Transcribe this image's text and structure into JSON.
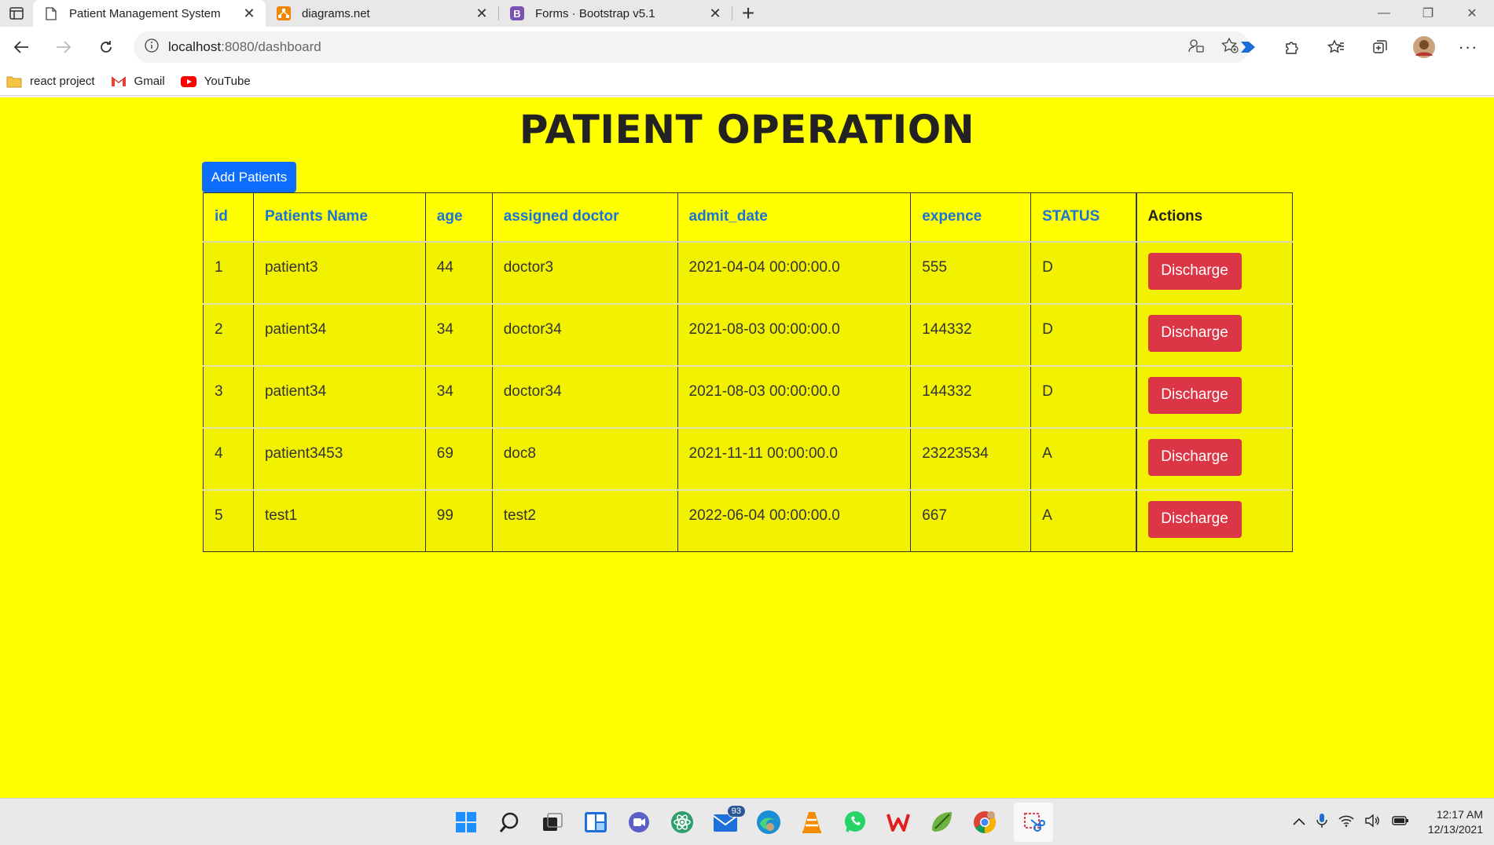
{
  "browser": {
    "tabs": [
      {
        "label": "Patient Management System",
        "active": true,
        "icon": "page-icon"
      },
      {
        "label": "diagrams.net",
        "active": false,
        "icon": "diagrams-icon"
      },
      {
        "label": "Forms · Bootstrap v5.1",
        "active": false,
        "icon": "bootstrap-icon"
      }
    ],
    "url_host": "localhost",
    "url_path": ":8080/dashboard",
    "bookmarks": [
      {
        "label": "react project",
        "icon": "folder-icon"
      },
      {
        "label": "Gmail",
        "icon": "gmail-icon"
      },
      {
        "label": "YouTube",
        "icon": "youtube-icon"
      }
    ]
  },
  "page": {
    "title": "PATIENT OPERATION",
    "add_button": "Add Patients",
    "columns": [
      "id",
      "Patients Name",
      "age",
      "assigned doctor",
      "admit_date",
      "expence",
      "STATUS",
      "Actions"
    ],
    "rows": [
      {
        "id": "1",
        "name": "patient3",
        "age": "44",
        "doctor": "doctor3",
        "admit_date": "2021-04-04 00:00:00.0",
        "expence": "555",
        "status": "D",
        "action": "Discharge"
      },
      {
        "id": "2",
        "name": "patient34",
        "age": "34",
        "doctor": "doctor34",
        "admit_date": "2021-08-03 00:00:00.0",
        "expence": "144332",
        "status": "D",
        "action": "Discharge"
      },
      {
        "id": "3",
        "name": "patient34",
        "age": "34",
        "doctor": "doctor34",
        "admit_date": "2021-08-03 00:00:00.0",
        "expence": "144332",
        "status": "D",
        "action": "Discharge"
      },
      {
        "id": "4",
        "name": "patient3453",
        "age": "69",
        "doctor": "doc8",
        "admit_date": "2021-11-11 00:00:00.0",
        "expence": "23223534",
        "status": "A",
        "action": "Discharge"
      },
      {
        "id": "5",
        "name": "test1",
        "age": "99",
        "doctor": "test2",
        "admit_date": "2022-06-04 00:00:00.0",
        "expence": "667",
        "status": "A",
        "action": "Discharge"
      }
    ]
  },
  "colors": {
    "page_background": "#ffff00",
    "primary_button": "#0d6efd",
    "danger_button": "#dc3545",
    "header_link": "#1a73d9"
  },
  "taskbar": {
    "mail_badge": "93",
    "time": "12:17 AM",
    "date": "12/13/2021"
  }
}
